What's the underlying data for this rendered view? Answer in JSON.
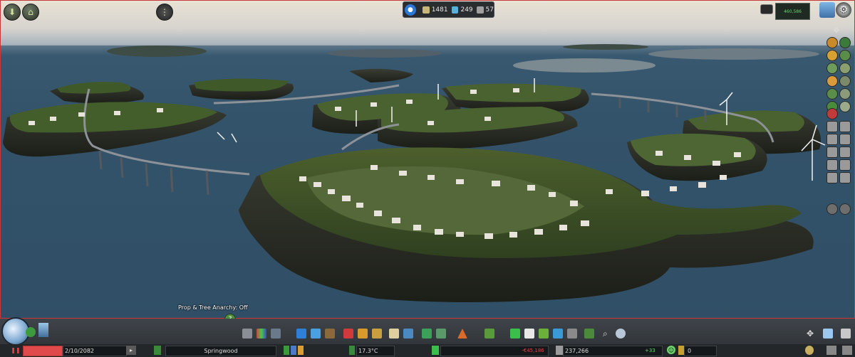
{
  "top_bar": {
    "stat_1": "1481",
    "stat_2": "249",
    "stat_3": "57",
    "money_panel_text": "460,586"
  },
  "overlay": {
    "anarchy_label": "Prop & Tree Anarchy: Off",
    "help_label": "?"
  },
  "status_bar": {
    "date": "2/10/2082",
    "city_name": "Springwood",
    "temperature": "17.3°C",
    "income": "-€45,186",
    "money": "237,266",
    "money_change": "+33",
    "happiness_value": "0"
  },
  "icons": {
    "top_left": [
      "zoom-out-icon",
      "unlock-icon",
      "traffic-light-icon"
    ],
    "toolbar": [
      "roads-icon",
      "zoning-icon",
      "districts-icon",
      "electricity-icon",
      "water-icon",
      "garbage-icon",
      "healthcare-icon",
      "fire-icon",
      "police-icon",
      "education-icon",
      "transport-icon",
      "beautification-icon",
      "monuments-icon",
      "wonders-icon",
      "landscaping-icon",
      "disasters-icon",
      "parks-icon",
      "decoration-icon",
      "search-icon",
      "weather-icon"
    ]
  },
  "colors": {
    "accent_red": "#d23535",
    "status_green": "#6bd46b",
    "info_blue": "#2c78d6"
  }
}
